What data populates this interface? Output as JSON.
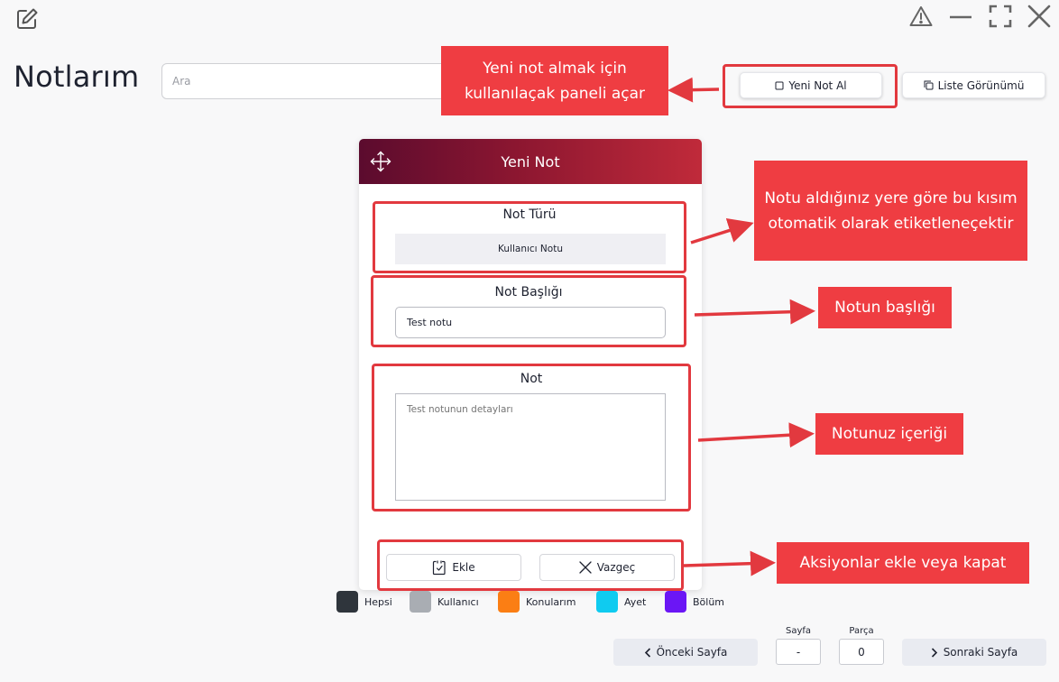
{
  "app": {
    "title": "Notlarım",
    "icon": "edit-note-icon"
  },
  "window_controls": [
    "warning-icon",
    "minimize-icon",
    "fullscreen-icon",
    "close-icon"
  ],
  "search": {
    "placeholder": "Ara",
    "value": ""
  },
  "toolbar": {
    "new_note_label": "Yeni Not Al",
    "list_view_label": "Liste Görünümü"
  },
  "panel": {
    "title": "Yeni Not",
    "note_type_label": "Not Türü",
    "note_type_value": "Kullanıcı Notu",
    "note_title_label": "Not Başlığı",
    "note_title_value": "Test notu",
    "note_label": "Not",
    "note_placeholder": "Test notunun detayları",
    "add_label": "Ekle",
    "cancel_label": "Vazgeç"
  },
  "callouts": {
    "new_note": "Yeni not almak için kullanılaçak paneli açar",
    "note_type": "Notu aldığınız yere göre bu kısım otomatik olarak etiketleneçektir",
    "note_title": "Notun başlığı",
    "note_content": "Notunuz içeriği",
    "actions": "Aksiyonlar ekle veya kapat"
  },
  "legend": [
    {
      "label": "Hepsi",
      "color": "#2f353c"
    },
    {
      "label": "Kullanıcı",
      "color": "#a9adb3"
    },
    {
      "label": "Konularım",
      "color": "#fb7e14"
    },
    {
      "label": "Ayet",
      "color": "#0fcbf0"
    },
    {
      "label": "Bölüm",
      "color": "#6b16f5"
    }
  ],
  "pager": {
    "prev_label": "Önceki Sayfa",
    "next_label": "Sonraki Sayfa",
    "page_label": "Sayfa",
    "page_value": "-",
    "part_label": "Parça",
    "part_value": "0"
  },
  "colors": {
    "accent_red": "#ef3d42",
    "header_gradient_start": "#5b0b2e",
    "header_gradient_end": "#c02a3a"
  }
}
